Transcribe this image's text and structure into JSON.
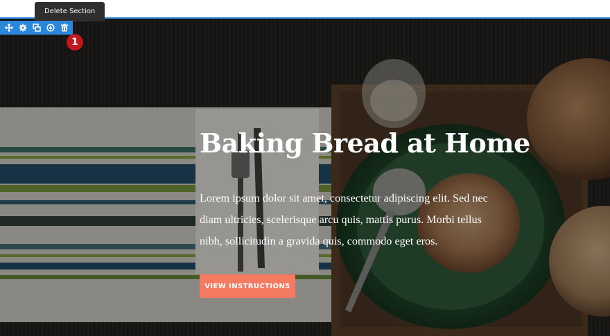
{
  "builder": {
    "tooltip": "Delete Section",
    "toolbar_icons": [
      "move-icon",
      "settings-icon",
      "duplicate-icon",
      "save-to-library-icon",
      "delete-icon"
    ],
    "badge_number": "1",
    "accent_color": "#2b87da",
    "badge_color": "#c1181e"
  },
  "hero": {
    "title": "Baking Bread at Home",
    "body": "Lorem ipsum dolor sit amet, consectetur adipiscing elit. Sed nec diam ultricies, scelerisque arcu quis, mattis purus. Morbi tellus nibh, sollicitudin a gravida quis, commodo eget eros.",
    "button_label": "VIEW INSTRUCTIONS",
    "button_color": "#f47a61"
  }
}
